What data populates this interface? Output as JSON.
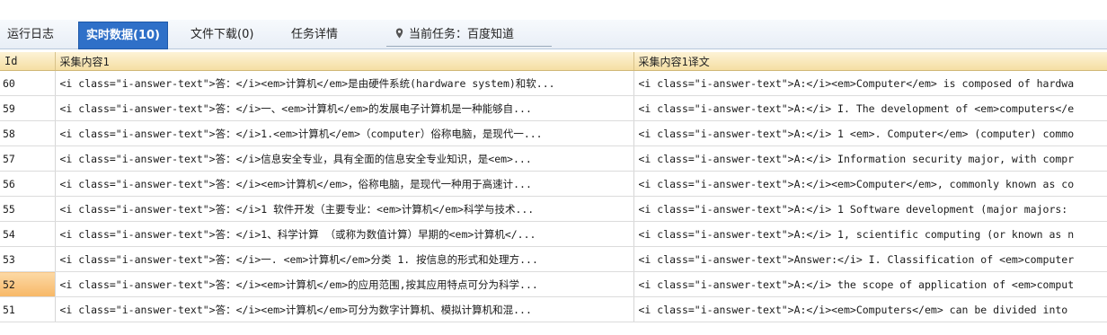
{
  "tabs": [
    {
      "label": "运行日志",
      "active": false
    },
    {
      "label": "实时数据(10)",
      "active": true
    },
    {
      "label": "文件下载(0)",
      "active": false
    },
    {
      "label": "任务详情",
      "active": false
    }
  ],
  "current_task": {
    "icon": "location-pin-icon",
    "text": "当前任务：百度知道"
  },
  "table": {
    "columns": [
      "Id",
      "采集内容1",
      "采集内容1译文"
    ],
    "rows": [
      {
        "id": "60",
        "content": "<i class=\"i-answer-text\">答：</i><em>计算机</em>是由硬件系统(hardware system)和软...",
        "translation": "<i class=\"i-answer-text\">A:</i><em>Computer</em> is composed of hardwa",
        "selected": false
      },
      {
        "id": "59",
        "content": "<i class=\"i-answer-text\">答：</i>一、<em>计算机</em>的发展电子计算机是一种能够自...",
        "translation": "<i class=\"i-answer-text\">A:</i> I. The development of <em>computers</e",
        "selected": false
      },
      {
        "id": "58",
        "content": "<i class=\"i-answer-text\">答：</i>1.<em>计算机</em>（computer）俗称电脑，是现代一...",
        "translation": "<i class=\"i-answer-text\">A:</i> 1 <em>. Computer</em> (computer) commo",
        "selected": false
      },
      {
        "id": "57",
        "content": "<i class=\"i-answer-text\">答：</i>信息安全专业，具有全面的信息安全专业知识，是<em>...",
        "translation": "<i class=\"i-answer-text\">A:</i> Information security major, with compr",
        "selected": false
      },
      {
        "id": "56",
        "content": "<i class=\"i-answer-text\">答：</i><em>计算机</em>，俗称电脑，是现代一种用于高速计...",
        "translation": "<i class=\"i-answer-text\">A:</i><em>Computer</em>, commonly known as co",
        "selected": false
      },
      {
        "id": "55",
        "content": "<i class=\"i-answer-text\">答：</i>1 软件开发（主要专业：<em>计算机</em>科学与技术...",
        "translation": "<i class=\"i-answer-text\">A:</i> 1 Software development (major majors:",
        "selected": false
      },
      {
        "id": "54",
        "content": "<i class=\"i-answer-text\">答：</i>1、科学计算 （或称为数值计算）早期的<em>计算机</...",
        "translation": "<i class=\"i-answer-text\">A:</i> 1, scientific computing (or known as n",
        "selected": false
      },
      {
        "id": "53",
        "content": "<i class=\"i-answer-text\">答：</i>一. <em>计算机</em>分类 1. 按信息的形式和处理方...",
        "translation": "<i class=\"i-answer-text\">Answer:</i> I. Classification of <em>computer",
        "selected": false
      },
      {
        "id": "52",
        "content": "<i class=\"i-answer-text\">答：</i><em>计算机</em>的应用范围,按其应用特点可分为科学...",
        "translation": "<i class=\"i-answer-text\">A:</i> the scope of application of <em>comput",
        "selected": true
      },
      {
        "id": "51",
        "content": "<i class=\"i-answer-text\">答：</i><em>计算机</em>可分为数字计算机、模拟计算机和混...",
        "translation": "<i class=\"i-answer-text\">A:</i><em>Computers</em> can be divided into",
        "selected": false
      }
    ]
  },
  "colors": {
    "active_tab": "#2f70c8",
    "header_bg": "#f5dfa3",
    "selected_id_bg": "#f7b766"
  }
}
